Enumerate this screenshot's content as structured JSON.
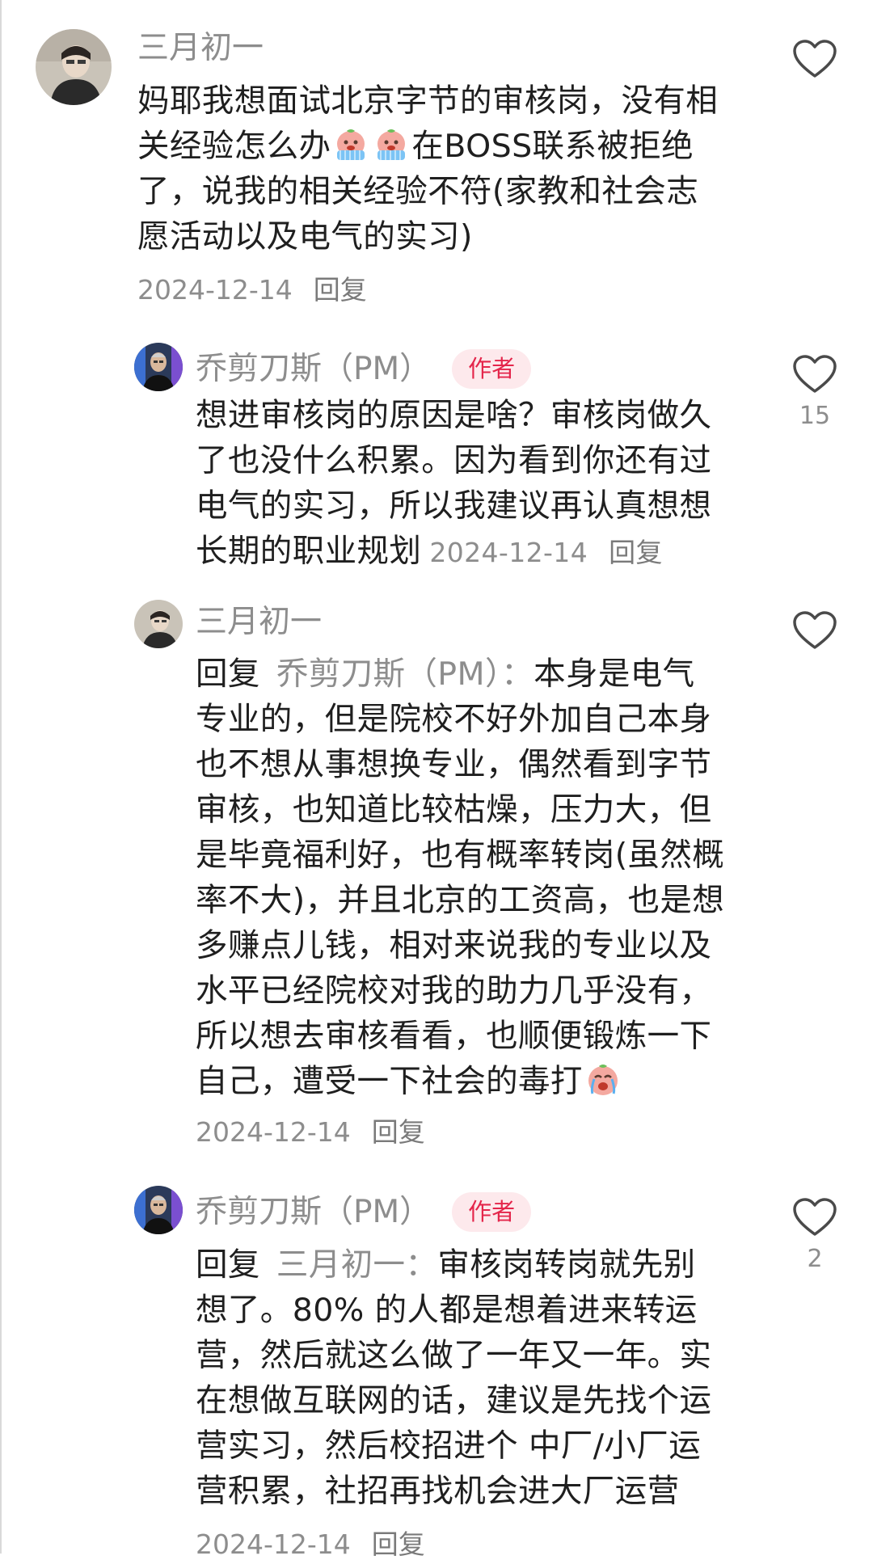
{
  "comments": [
    {
      "username": "三月初一",
      "is_author": false,
      "lines": [
        "妈耶我想面试北京字节的审核岗，没有相",
        "关经验怎么办",
        "在BOSS联系被拒绝",
        "了，说我的相关经验不符(家教和社会志",
        "愿活动以及电气的实习)"
      ],
      "date": "2024-12-14",
      "reply_label": "回复",
      "like_count": "",
      "emojis": [
        "crying-face-emoji",
        "crying-face-emoji"
      ]
    },
    {
      "username": "乔剪刀斯（PM）",
      "is_author": true,
      "badge": "作者",
      "lines": [
        "想进审核岗的原因是啥？审核岗做久",
        "了也没什么积累。因为看到你还有过",
        "电气的实习，所以我建议再认真想想",
        "长期的职业规划"
      ],
      "date": "2024-12-14",
      "reply_label": "回复",
      "like_count": "15"
    },
    {
      "username": "三月初一",
      "is_author": false,
      "reply_prefix": "回复",
      "reply_target": "乔剪刀斯（PM）：",
      "first_line_rest": "本身是电气",
      "lines": [
        "专业的，但是院校不好外加自己本身",
        "也不想从事想换专业，偶然看到字节",
        "审核，也知道比较枯燥，压力大，但",
        "是毕竟福利好，也有概率转岗(虽然概",
        "率不大)，并且北京的工资高，也是想",
        "多赚点儿钱，相对来说我的专业以及",
        "水平已经院校对我的助力几乎没有，",
        "所以想去审核看看，也顺便锻炼一下",
        "自己，遭受一下社会的毒打"
      ],
      "date": "2024-12-14",
      "reply_label": "回复",
      "like_count": ""
    },
    {
      "username": "乔剪刀斯（PM）",
      "is_author": true,
      "badge": "作者",
      "reply_prefix": "回复",
      "reply_target": "三月初一：",
      "first_line_rest": "审核岗转岗就先别",
      "lines": [
        "想了。80% 的人都是想着进来转运",
        "营，然后就这么做了一年又一年。实",
        "在想做互联网的话，建议是先找个运",
        "营实习，然后校招进个 中厂/小厂运",
        "营积累，社招再找机会进大厂运营"
      ],
      "date": "2024-12-14",
      "reply_label": "回复",
      "like_count": "2"
    }
  ],
  "icons": {
    "like": "heart-outline-icon",
    "emoji": "crying-face-emoji"
  },
  "colors": {
    "username": "#8d8d8d",
    "badge_bg": "#fde9ec",
    "badge_text": "#e4264b",
    "text": "#1f1f1f",
    "meta": "#8d8d8d"
  }
}
